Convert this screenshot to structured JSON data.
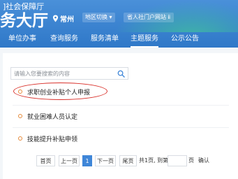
{
  "header": {
    "logo_line1": "]社会保障厅",
    "logo_line2": "务大厅",
    "city": "常州",
    "switch_label": "地区切换 ▾",
    "portal_label": "省人社门户网站 ⅱ"
  },
  "nav": {
    "items": [
      "单位办事",
      "查询服务",
      "服务清单",
      "主题服务",
      "公示公告"
    ],
    "active": "主题服务"
  },
  "search": {
    "placeholder": "请输入您要搜索的内容"
  },
  "list": {
    "items": [
      "求职创业补贴个人申报",
      "就业困难人员认定",
      "技能提升补贴申领"
    ]
  },
  "pager": {
    "first": "首页",
    "prev": "上一页",
    "current": "1",
    "next": "下一页",
    "last": "尾页",
    "summary": "共1页, 到第",
    "page_unit": "页",
    "confirm": "确认"
  },
  "colors": {
    "header": "#3680cf",
    "accent": "#3f86d8",
    "dot": "#e58a3a",
    "annotation": "#d9312b"
  }
}
